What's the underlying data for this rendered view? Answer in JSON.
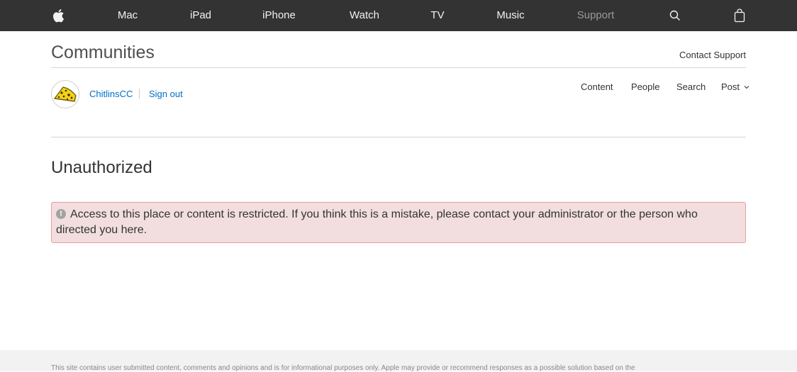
{
  "global_nav": {
    "apple_icon": "apple-logo-icon",
    "items": [
      {
        "label": "Mac"
      },
      {
        "label": "iPad"
      },
      {
        "label": "iPhone"
      },
      {
        "label": "Watch"
      },
      {
        "label": "TV"
      },
      {
        "label": "Music"
      },
      {
        "label": "Support"
      }
    ],
    "search_icon": "search-icon",
    "bag_icon": "shopping-bag-icon"
  },
  "header": {
    "title": "Communities",
    "contact_support": "Contact Support"
  },
  "user": {
    "name": "ChitlinsCC",
    "sign_out": "Sign out",
    "avatar_icon": "cheese-avatar-icon"
  },
  "local_nav": {
    "items": [
      {
        "label": "Content"
      },
      {
        "label": "People"
      },
      {
        "label": "Search"
      },
      {
        "label": "Post"
      }
    ]
  },
  "main": {
    "page_title": "Unauthorized",
    "alert_text": "Access to this place or content is restricted. If you think this is a mistake, please contact your administrator or the person who directed you here."
  },
  "footer": {
    "text": "This site contains user submitted content, comments and opinions and is for informational purposes only. Apple may provide or recommend responses as a possible solution based on the"
  },
  "colors": {
    "nav_bg": "#333333",
    "link": "#0070c9",
    "alert_bg": "#f2dede",
    "alert_border": "#eb9aa0"
  }
}
